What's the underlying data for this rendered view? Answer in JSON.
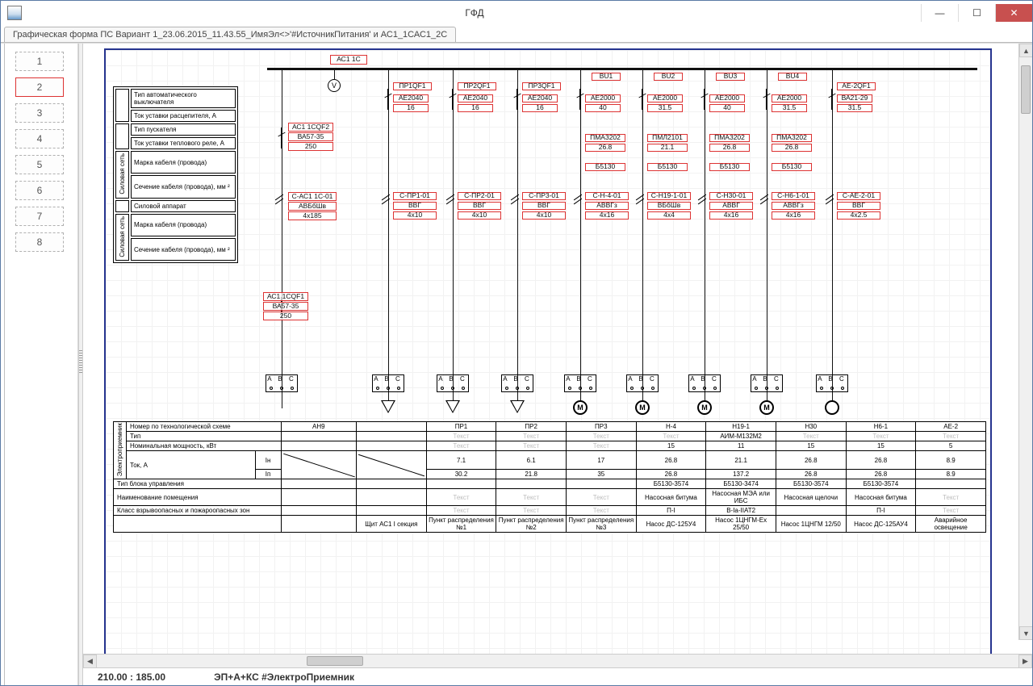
{
  "window": {
    "title": "ГФД"
  },
  "tab": "Графическая форма ПС Вариант 1_23.06.2015_11.43.55_ИмяЭл<>'#ИсточникПитания' и АС1_1САС1_2С",
  "status": {
    "coords": "210.00 : 185.00",
    "path": "ЭП+А+КС #ЭлектроПриемник"
  },
  "pages": [
    "1",
    "2",
    "3",
    "4",
    "5",
    "6",
    "7",
    "8"
  ],
  "selected_page": "2",
  "bus_label": "АС1 1С",
  "legend": {
    "rows": [
      "Тип автоматического выключателя",
      "Ток уставки расцепителя, А",
      "Тип пускателя",
      "Ток уставки теплового реле, А",
      "Марка кабеля (провода)",
      "Сечение кабеля (провода), мм   ²",
      "Силовой аппарат",
      "Марка кабеля (провода)",
      "Сечение кабеля (провода), мм   ²"
    ],
    "vgroups": [
      "Силовая сеть",
      "Силовая сеть"
    ]
  },
  "incomer": {
    "top": [
      "АС1 1СQF2",
      "ВА57-35",
      "250"
    ],
    "bottom": [
      "АС1 1СQF1",
      "ВА57-35",
      "250"
    ]
  },
  "incomer_cable": {
    "code": "С-АС1 1С-01",
    "type": "АВБбШв",
    "size": "4x185"
  },
  "q_top": [
    "ПР1QF1",
    "ПР2QF1",
    "ПР3QF1"
  ],
  "bu": [
    "BU1",
    "BU2",
    "BU3",
    "BU4"
  ],
  "ae2qf1": "АЕ-2QF1",
  "row_ae_type": [
    "АЕ2040",
    "АЕ2040",
    "АЕ2040",
    "АЕ2000",
    "АЕ2000",
    "АЕ2000",
    "АЕ2000",
    "ВА21-29"
  ],
  "row_ae_cur": [
    "16",
    "16",
    "16",
    "40",
    "31.5",
    "40",
    "31.5",
    "31.5"
  ],
  "row_pma_type": [
    "ПМА3202",
    "ПМЛ2101",
    "ПМА3202",
    "ПМА3202"
  ],
  "row_pma_cur": [
    "26.8",
    "21.1",
    "26.8",
    "26.8"
  ],
  "row_b5130": [
    "Б5130",
    "Б5130",
    "Б5130",
    "Б5130"
  ],
  "row_cable_code": [
    "С-ПР1-01",
    "С-ПР2-01",
    "С-ПР3-01",
    "С-Н-4-01",
    "С-Н19-1-01",
    "С-Н30-01",
    "С-Н6-1-01",
    "С-АЕ-2-01"
  ],
  "row_cable_type": [
    "ВВГ",
    "ВВГ",
    "ВВГ",
    "АВВГз",
    "ВБбШв",
    "АВВГ",
    "АВВГз",
    "ВВГ"
  ],
  "row_cable_size": [
    "4x10",
    "4x10",
    "4x10",
    "4x16",
    "4x4",
    "4x16",
    "4x16",
    "4x2.5"
  ],
  "tbl": {
    "headers": {
      "scheme": "Номер по технологической схеме",
      "type": "Тип",
      "power": "Номинальная мощность, кВт",
      "cur": "Ток, А",
      "im": "Iн",
      "in": "Iп",
      "ctrl": "Тип блока управления",
      "room": "Наименование помещения",
      "zone": "Класс взрывоопасных и пожароопасных зон",
      "vh": "Электроприемник"
    },
    "col_scheme": [
      "АН9",
      "",
      "ПР1",
      "ПР2",
      "ПР3",
      "Н-4",
      "Н19-1",
      "Н30",
      "Н6-1",
      "АЕ-2"
    ],
    "col_type": [
      "",
      "",
      "Текст",
      "Текст",
      "Текст",
      "Текст",
      "АИМ-М132М2",
      "Текст",
      "Текст",
      "Текст"
    ],
    "col_power": [
      "",
      "",
      "Текст",
      "Текст",
      "Текст",
      "15",
      "11",
      "15",
      "15",
      "5"
    ],
    "col_im": [
      "",
      "",
      "7.1",
      "6.1",
      "17",
      "26.8",
      "21.1",
      "26.8",
      "26.8",
      "8.9"
    ],
    "col_in": [
      "",
      "",
      "30.2",
      "21.8",
      "35",
      "26.8",
      "137.2",
      "26.8",
      "26.8",
      "8.9"
    ],
    "col_ctrl": [
      "",
      "",
      "",
      "",
      "",
      "Б5130-3574",
      "Б5130-3474",
      "Б5130-3574",
      "Б5130-3574",
      ""
    ],
    "col_room": [
      "",
      "",
      "Текст",
      "Текст",
      "Текст",
      "Насосная битума",
      "Насосная МЭА или ИБС",
      "Насосная щелочи",
      "Насосная битума",
      "Текст"
    ],
    "col_zone": [
      "",
      "",
      "Текст",
      "Текст",
      "Текст",
      "П-I",
      "В-Iа-IIАТ2",
      "",
      "П-I",
      "Текст"
    ],
    "col_foot": [
      "",
      "Щит АС1 I секция",
      "Пункт распределения №1",
      "Пункт распределения №2",
      "Пункт распределения №3",
      "Насос ДС-125У4",
      "Насос 1ЦНГМ-Ех 25/50",
      "Насос 1ЦНГМ 12/50",
      "Насос ДС-125АУ4",
      "Аварийное освещение"
    ]
  },
  "placeholder": "Текст"
}
